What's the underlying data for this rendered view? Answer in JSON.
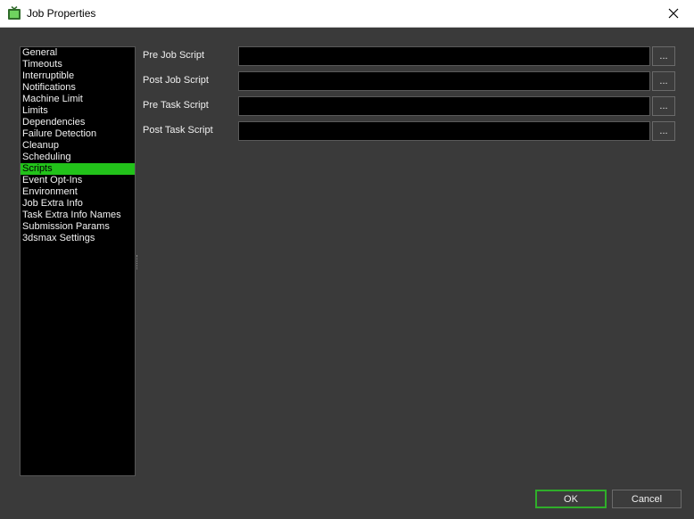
{
  "window": {
    "title": "Job Properties",
    "icon": "app-tv-icon",
    "close_icon": "close-icon"
  },
  "nav": {
    "items": [
      {
        "label": "General"
      },
      {
        "label": "Timeouts"
      },
      {
        "label": "Interruptible"
      },
      {
        "label": "Notifications"
      },
      {
        "label": "Machine Limit"
      },
      {
        "label": "Limits"
      },
      {
        "label": "Dependencies"
      },
      {
        "label": "Failure Detection"
      },
      {
        "label": "Cleanup"
      },
      {
        "label": "Scheduling"
      },
      {
        "label": "Scripts",
        "selected": true
      },
      {
        "label": "Event Opt-Ins"
      },
      {
        "label": "Environment"
      },
      {
        "label": "Job Extra Info"
      },
      {
        "label": "Task Extra Info Names"
      },
      {
        "label": "Submission Params"
      },
      {
        "label": "3dsmax Settings"
      }
    ],
    "selected_color": "#22c21a"
  },
  "scripts": {
    "rows": [
      {
        "label": "Pre Job Script",
        "value": "",
        "browse": "..."
      },
      {
        "label": "Post Job Script",
        "value": "",
        "browse": "..."
      },
      {
        "label": "Pre Task Script",
        "value": "",
        "browse": "..."
      },
      {
        "label": "Post Task Script",
        "value": "",
        "browse": "..."
      }
    ]
  },
  "buttons": {
    "ok": "OK",
    "cancel": "Cancel",
    "ok_border_color": "#2fae2a"
  }
}
